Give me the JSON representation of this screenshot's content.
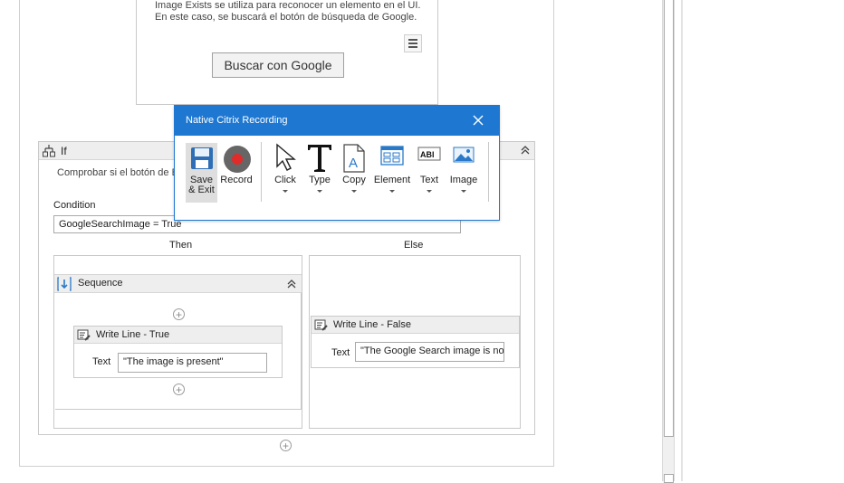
{
  "image_exists": {
    "description_line1": "Image Exists se utiliza para reconocer un elemento en el UI.",
    "description_line2": "En este caso, se buscará el botón de búsqueda de Google.",
    "button_label": "Buscar con Google"
  },
  "if_activity": {
    "title": "If",
    "description": "Comprobar si el botón de B",
    "condition_label": "Condition",
    "condition_value": "GoogleSearchImage = True",
    "then_label": "Then",
    "else_label": "Else"
  },
  "sequence": {
    "title": "Sequence"
  },
  "write_line_true": {
    "title": "Write Line - True",
    "text_label": "Text",
    "text_value": "\"The image is present\""
  },
  "write_line_false": {
    "title": "Write Line - False",
    "text_label": "Text",
    "text_value": "\"The Google Search image is not"
  },
  "recording": {
    "title": "Native Citrix Recording",
    "accent": "#1e78d2",
    "buttons": {
      "save_line1": "Save",
      "save_line2": "& Exit",
      "record": "Record",
      "click": "Click",
      "type": "Type",
      "copy": "Copy",
      "element": "Element",
      "text": "Text",
      "image": "Image"
    }
  }
}
